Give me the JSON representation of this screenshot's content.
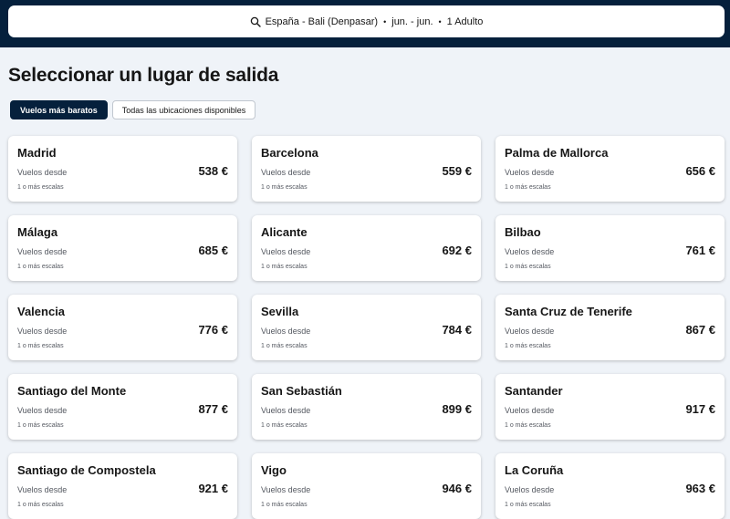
{
  "header": {
    "search": {
      "route": "España - Bali (Denpasar)",
      "dates": "jun. - jun.",
      "travellers": "1 Adulto",
      "separator": "•"
    }
  },
  "main": {
    "title": "Seleccionar un lugar de salida",
    "tabs": [
      {
        "label": "Vuelos más baratos",
        "active": true
      },
      {
        "label": "Todas las ubicaciones disponibles",
        "active": false
      }
    ],
    "cards": [
      {
        "city": "Madrid",
        "from_label": "Vuelos desde",
        "price": "538 €",
        "stops": "1 o más escalas"
      },
      {
        "city": "Barcelona",
        "from_label": "Vuelos desde",
        "price": "559 €",
        "stops": "1 o más escalas"
      },
      {
        "city": "Palma de Mallorca",
        "from_label": "Vuelos desde",
        "price": "656 €",
        "stops": "1 o más escalas"
      },
      {
        "city": "Málaga",
        "from_label": "Vuelos desde",
        "price": "685 €",
        "stops": "1 o más escalas"
      },
      {
        "city": "Alicante",
        "from_label": "Vuelos desde",
        "price": "692 €",
        "stops": "1 o más escalas"
      },
      {
        "city": "Bilbao",
        "from_label": "Vuelos desde",
        "price": "761 €",
        "stops": "1 o más escalas"
      },
      {
        "city": "Valencia",
        "from_label": "Vuelos desde",
        "price": "776 €",
        "stops": "1 o más escalas"
      },
      {
        "city": "Sevilla",
        "from_label": "Vuelos desde",
        "price": "784 €",
        "stops": "1 o más escalas"
      },
      {
        "city": "Santa Cruz de Tenerife",
        "from_label": "Vuelos desde",
        "price": "867 €",
        "stops": "1 o más escalas"
      },
      {
        "city": "Santiago del Monte",
        "from_label": "Vuelos desde",
        "price": "877 €",
        "stops": "1 o más escalas"
      },
      {
        "city": "San Sebastián",
        "from_label": "Vuelos desde",
        "price": "899 €",
        "stops": "1 o más escalas"
      },
      {
        "city": "Santander",
        "from_label": "Vuelos desde",
        "price": "917 €",
        "stops": "1 o más escalas"
      },
      {
        "city": "Santiago de Compostela",
        "from_label": "Vuelos desde",
        "price": "921 €",
        "stops": "1 o más escalas"
      },
      {
        "city": "Vigo",
        "from_label": "Vuelos desde",
        "price": "946 €",
        "stops": "1 o más escalas"
      },
      {
        "city": "La Coruña",
        "from_label": "Vuelos desde",
        "price": "963 €",
        "stops": "1 o más escalas"
      }
    ]
  },
  "icons": {
    "search": "search-icon"
  },
  "colors": {
    "header_bg": "#05203c",
    "page_bg": "#eff3f8",
    "active_tab_bg": "#05203c",
    "card_bg": "#ffffff",
    "muted_text": "#545860"
  }
}
